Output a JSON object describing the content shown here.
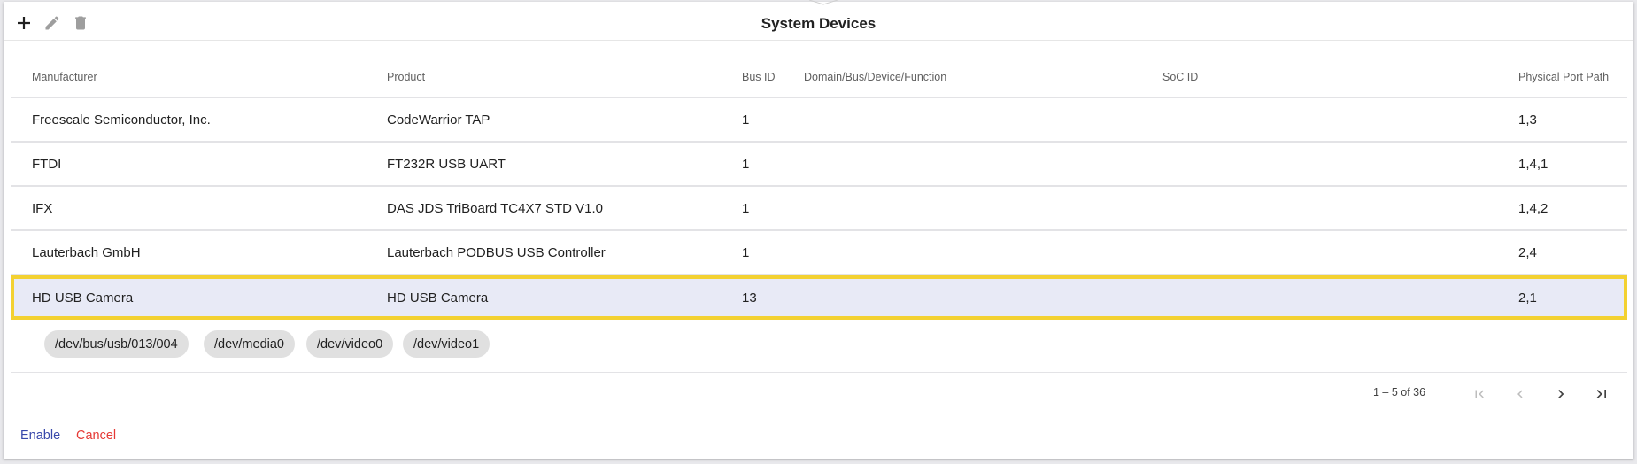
{
  "dialog": {
    "title": "System Devices"
  },
  "toolbar": {
    "add_icon": "plus-icon",
    "edit_icon": "pencil-icon",
    "delete_icon": "trash-icon"
  },
  "table": {
    "columns": [
      "Manufacturer",
      "Product",
      "Bus ID",
      "Domain/Bus/Device/Function",
      "SoC ID",
      "Physical Port Path"
    ],
    "rows": [
      {
        "manufacturer": "Freescale Semiconductor, Inc.",
        "product": "CodeWarrior TAP",
        "bus_id": "1",
        "dbdf": "",
        "soc_id": "",
        "port_path": "1,3"
      },
      {
        "manufacturer": "FTDI",
        "product": "FT232R USB UART",
        "bus_id": "1",
        "dbdf": "",
        "soc_id": "",
        "port_path": "1,4,1"
      },
      {
        "manufacturer": "IFX",
        "product": "DAS JDS TriBoard TC4X7 STD V1.0",
        "bus_id": "1",
        "dbdf": "",
        "soc_id": "",
        "port_path": "1,4,2"
      },
      {
        "manufacturer": "Lauterbach GmbH",
        "product": "Lauterbach PODBUS USB Controller",
        "bus_id": "1",
        "dbdf": "",
        "soc_id": "",
        "port_path": "2,4"
      },
      {
        "manufacturer": "HD USB Camera",
        "product": "HD USB Camera",
        "bus_id": "13",
        "dbdf": "",
        "soc_id": "",
        "port_path": "2,1"
      }
    ],
    "selected_row": 4,
    "device_nodes": [
      "/dev/bus/usb/013/004",
      "/dev/media0",
      "/dev/video0",
      "/dev/video1"
    ]
  },
  "paginator": {
    "range_label": "1 – 5 of 36",
    "first_icon": "first-page-icon",
    "prev_icon": "chevron-left-icon",
    "next_icon": "chevron-right-icon",
    "last_icon": "last-page-icon"
  },
  "actions": {
    "enable_label": "Enable",
    "cancel_label": "Cancel"
  },
  "colors": {
    "selection_bg": "#e8eaf6",
    "selection_outline": "#f3d131",
    "enable": "#3949ab",
    "cancel": "#e53935"
  }
}
